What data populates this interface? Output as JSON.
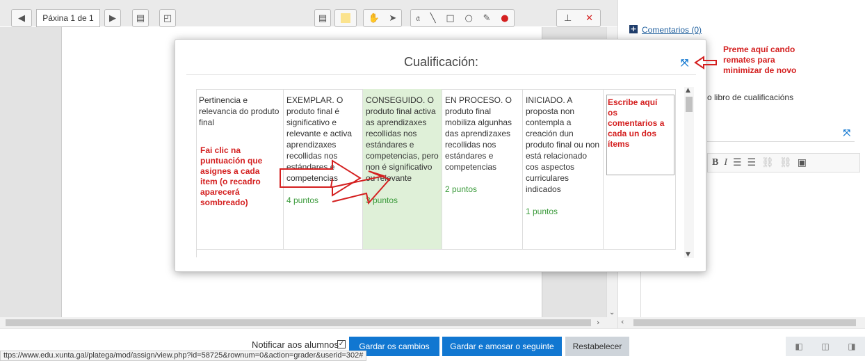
{
  "toolbar": {
    "page_label": "Páxina 1 de 1"
  },
  "panel": {
    "comments_link": "Comentarios (0)",
    "gradebook_text": "o libro de cualificacións"
  },
  "modal": {
    "title": "Cualificación:",
    "comment_placeholder_annotation": "Escribe aquí os comentarios a cada un dos ítems",
    "criterion": "Pertinencia e relevancia do produto final",
    "levels": [
      {
        "desc": "EXEMPLAR. O produto final é significativo e relevante e activa aprendizaxes recollidas nos estándares e competencias",
        "points": "4  puntos"
      },
      {
        "desc": "CONSEGUIDO. O produto final activa as aprendizaxes recollidas nos estándares e competencias, pero non é significativo ou relevante",
        "points": "3  puntos"
      },
      {
        "desc": "EN PROCESO. O produto final mobiliza algunhas das aprendizaxes recollidas nos estándares e competencias",
        "points": "2  puntos"
      },
      {
        "desc": "INICIADO. A proposta non contempla a creación dun produto final ou non está relacionado cos aspectos curriculares indicados",
        "points": "1  puntos"
      }
    ]
  },
  "annotations": {
    "minimize": "Preme aquí cando remates para minimizar de novo",
    "click_score": "Fai clic na puntuación que asignes a cada item (o recadro aparecerá sombreado)"
  },
  "bottom": {
    "notify_label": "Notificar aos alumnos",
    "save_label": "Gardar os cambios",
    "save_next_label": "Gardar e amosar o seguinte",
    "reset_label": "Restabelecer",
    "status_url": "ttps://www.edu.xunta.gal/platega/mod/assign/view.php?id=58725&rownum=0&action=grader&userid=302#"
  },
  "colors": {
    "accent": "#1177d1",
    "selected_level": "#dff0d8",
    "annotation": "#d42020",
    "points": "#3a9a3a"
  }
}
